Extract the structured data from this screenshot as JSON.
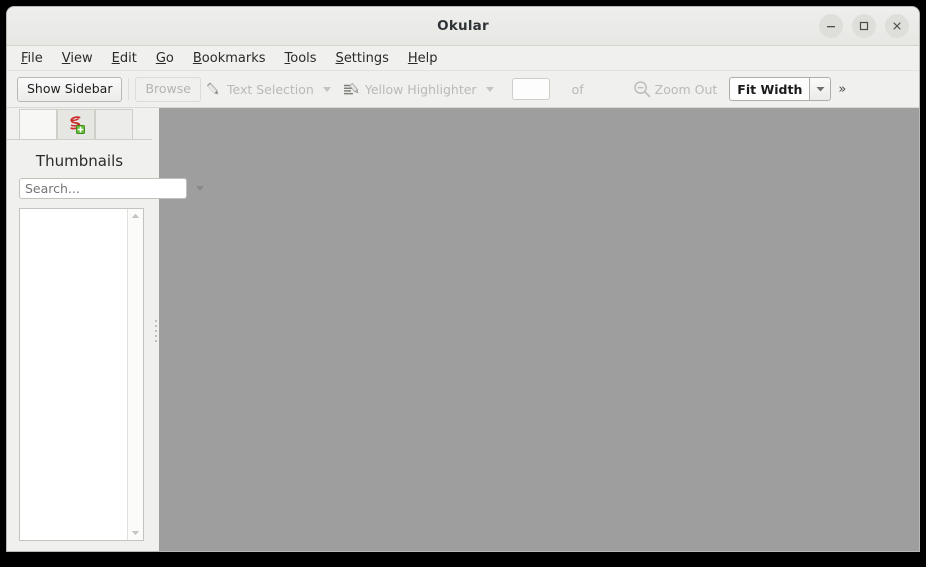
{
  "window": {
    "title": "Okular",
    "controls": [
      {
        "name": "minimize-button",
        "glyph": "minimize"
      },
      {
        "name": "maximize-button",
        "glyph": "maximize"
      },
      {
        "name": "close-button",
        "glyph": "close"
      }
    ]
  },
  "menubar": {
    "items": [
      {
        "label": "File",
        "mnemonic": "F"
      },
      {
        "label": "View",
        "mnemonic": "V"
      },
      {
        "label": "Edit",
        "mnemonic": "E"
      },
      {
        "label": "Go",
        "mnemonic": "G"
      },
      {
        "label": "Bookmarks",
        "mnemonic": "B"
      },
      {
        "label": "Tools",
        "mnemonic": "T"
      },
      {
        "label": "Settings",
        "mnemonic": "S"
      },
      {
        "label": "Help",
        "mnemonic": "H"
      }
    ]
  },
  "toolbar": {
    "show_sidebar_label": "Show Sidebar",
    "browse_label": "Browse",
    "text_selection_label": "Text Selection",
    "text_selection_icon": "pencil-icon",
    "yellow_highlighter_label": "Yellow Highlighter",
    "yellow_highlighter_icon": "highlighter-icon",
    "page_number_value": "",
    "page_number_placeholder": "",
    "of_label": "of",
    "zoom_out_label": "Zoom Out",
    "zoom_out_icon": "magnifier-minus-icon",
    "zoom_level_value": "Fit Width",
    "overflow_label": "»"
  },
  "sidebar": {
    "tabs": [
      {
        "name": "tab-thumbnails",
        "icon": "blank-icon",
        "selected": true
      },
      {
        "name": "tab-annotations",
        "icon": "annotations-icon",
        "selected": false
      },
      {
        "name": "tab-extra",
        "icon": "blank-icon",
        "selected": false
      }
    ],
    "panel_title": "Thumbnails",
    "search_value": "",
    "search_placeholder": "Search...",
    "search_options_icon": "chevron-down-icon",
    "thumbnails": []
  },
  "viewport": {
    "background_color": "#9e9e9e",
    "content": ""
  },
  "colors": {
    "window_chrome": "#f0f0ef",
    "titlebar": "#eeeeec",
    "viewport_gray": "#9e9e9e",
    "disabled_text": "#b9b9b5",
    "annotation_icon_red": "#d03030",
    "annotation_badge_green": "#5aa02c"
  }
}
